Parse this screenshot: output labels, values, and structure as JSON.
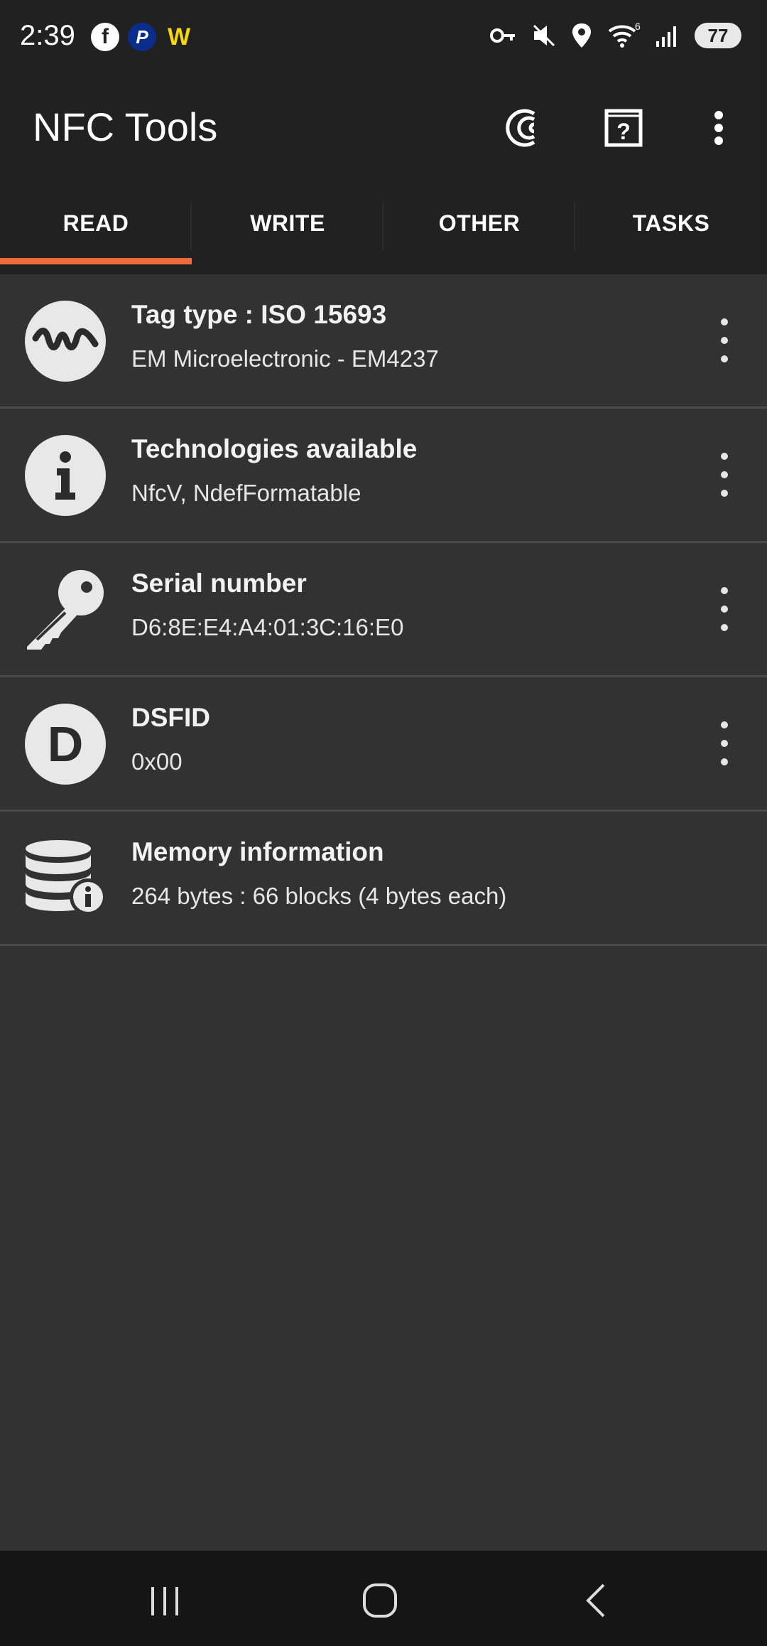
{
  "status": {
    "time": "2:39",
    "battery": "77",
    "wifi_badge": "6",
    "left_icons": [
      "facebook-icon",
      "paypal-icon",
      "wonder-icon"
    ],
    "right_icons": [
      "vpn-key-icon",
      "mute-icon",
      "location-icon",
      "wifi-icon",
      "signal-icon"
    ]
  },
  "app": {
    "title": "NFC Tools"
  },
  "tabs": [
    {
      "label": "READ",
      "active": true
    },
    {
      "label": "WRITE",
      "active": false
    },
    {
      "label": "OTHER",
      "active": false
    },
    {
      "label": "TASKS",
      "active": false
    }
  ],
  "rows": [
    {
      "icon": "wave-icon",
      "title": "Tag type : ISO 15693",
      "subtitle": "EM Microelectronic - EM4237",
      "has_menu": true
    },
    {
      "icon": "info-icon",
      "title": "Technologies available",
      "subtitle": "NfcV, NdefFormatable",
      "has_menu": true
    },
    {
      "icon": "key-icon",
      "title": "Serial number",
      "subtitle": "D6:8E:E4:A4:01:3C:16:E0",
      "has_menu": true
    },
    {
      "icon": "letter-d-icon",
      "letter": "D",
      "title": "DSFID",
      "subtitle": "0x00",
      "has_menu": true
    },
    {
      "icon": "database-info-icon",
      "title": "Memory information",
      "subtitle": "264 bytes : 66 blocks (4 bytes each)",
      "has_menu": false
    }
  ],
  "colors": {
    "accent": "#ef6c3a",
    "appbar": "#212121",
    "background": "#323232",
    "divider": "#4a4a4a"
  }
}
